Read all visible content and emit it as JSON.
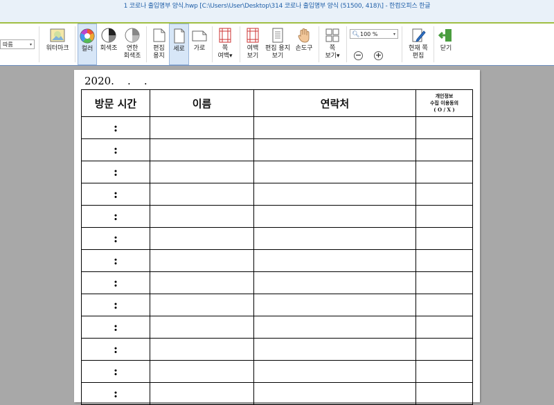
{
  "window": {
    "title": "1 코로나 출입명부 양식.hwp [C:\\Users\\User\\Desktop\\314 코로나 출입명부 양식 (51500, 418)\\] - 한컴오피스 한글"
  },
  "ribbon": {
    "left_dropdown": "따름",
    "watermark": "워터마크",
    "color": "컬러",
    "grayscale": "회색조",
    "light_grayscale": "연한\n회색조",
    "edit_paper": "편집\n용지",
    "portrait": "세로",
    "landscape": "가로",
    "page_margin": "쪽\n여백▾",
    "margin_view": "여백\n보기",
    "edit_paper_view": "편집 용지\n보기",
    "hand_tool": "손도구",
    "page_view": "쪽\n보기▾",
    "zoom": "100 %",
    "current_page_edit": "현재 쪽\n편집",
    "close": "닫기"
  },
  "document": {
    "date": "2020.    .    .",
    "headers": {
      "visit_time": "방문 시간",
      "name": "이름",
      "contact": "연락처",
      "consent_line1": "개인정보",
      "consent_line2": "수집 이용동의",
      "consent_line3": "( O / X )"
    },
    "rows": [
      ":",
      ":",
      ":",
      ":",
      ":",
      ":",
      ":",
      ":",
      ":",
      ":",
      ":",
      ":",
      ":"
    ]
  }
}
